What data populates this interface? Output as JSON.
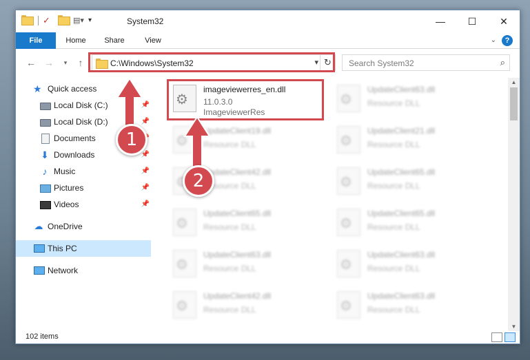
{
  "window": {
    "title": "System32",
    "controls": {
      "minimize": "—",
      "maximize": "☐",
      "close": "✕"
    }
  },
  "ribbon": {
    "tabs": [
      {
        "label": "File"
      },
      {
        "label": "Home"
      },
      {
        "label": "Share"
      },
      {
        "label": "View"
      }
    ],
    "help": "?"
  },
  "navigation": {
    "address_path": "C:\\Windows\\System32",
    "search_placeholder": "Search System32"
  },
  "sidebar": {
    "items": [
      {
        "label": "Quick access",
        "icon": "star-icon",
        "pinned": false
      },
      {
        "label": "Local Disk (C:)",
        "icon": "disk-icon",
        "pinned": true
      },
      {
        "label": "Local Disk (D:)",
        "icon": "disk-icon",
        "pinned": true
      },
      {
        "label": "Documents",
        "icon": "documents-icon",
        "pinned": true
      },
      {
        "label": "Downloads",
        "icon": "downloads-icon",
        "pinned": true
      },
      {
        "label": "Music",
        "icon": "music-icon",
        "pinned": true
      },
      {
        "label": "Pictures",
        "icon": "pictures-icon",
        "pinned": true
      },
      {
        "label": "Videos",
        "icon": "videos-icon",
        "pinned": true
      },
      {
        "label": "OneDrive",
        "icon": "onedrive-icon",
        "pinned": false
      },
      {
        "label": "This PC",
        "icon": "this-pc-icon",
        "pinned": false,
        "selected": true
      },
      {
        "label": "Network",
        "icon": "network-icon",
        "pinned": false
      }
    ]
  },
  "files": [
    {
      "name": "imageviewerres_en.dll",
      "version": "11.0.3.0",
      "description": "ImageviewerRes",
      "highlighted": true
    },
    {
      "name": "UpdateClient63.dll",
      "description": "Resource DLL"
    },
    {
      "name": "UpdateClient19.dll",
      "description": "Resource DLL"
    },
    {
      "name": "UpdateClient21.dll",
      "description": "Resource DLL"
    },
    {
      "name": "UpdateClient42.dll",
      "description": "Resource DLL"
    },
    {
      "name": "UpdateClient65.dll",
      "description": "Resource DLL"
    },
    {
      "name": "UpdateClient65.dll",
      "description": "Resource DLL"
    },
    {
      "name": "UpdateClient65.dll",
      "description": "Resource DLL"
    },
    {
      "name": "UpdateClient63.dll",
      "description": "Resource DLL"
    },
    {
      "name": "UpdateClient63.dll",
      "description": "Resource DLL"
    },
    {
      "name": "UpdateClient42.dll",
      "description": "Resource DLL"
    },
    {
      "name": "UpdateClient63.dll",
      "description": "Resource DLL"
    }
  ],
  "status": {
    "item_count": "102 items"
  },
  "annotations": {
    "step1": "1",
    "step2": "2",
    "accent_color": "#d24a4f"
  }
}
